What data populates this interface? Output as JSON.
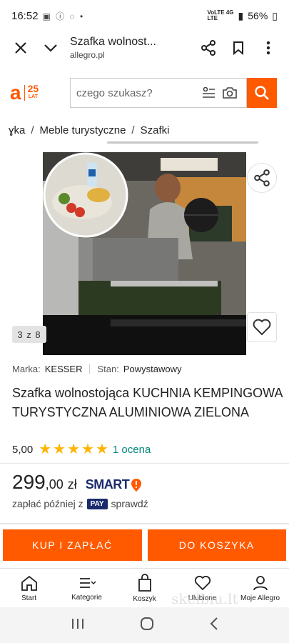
{
  "status_bar": {
    "time": "16:52",
    "battery": "56%",
    "network_top": "VoLTE 4G",
    "network_bottom": "LTE"
  },
  "browser": {
    "title": "Szafka wolnost...",
    "url": "allegro.pl",
    "icons": [
      "close-icon",
      "chevron-down-icon",
      "share-icon",
      "bookmark-icon",
      "more-icon"
    ]
  },
  "header": {
    "logo_letter": "a",
    "logo_anniversary": "25",
    "logo_lat": "LAT",
    "search_placeholder": "czego szukasz?"
  },
  "breadcrumb": [
    {
      "label": "ɣka"
    },
    {
      "label": "Meble turystyczne"
    },
    {
      "label": "Szafki"
    }
  ],
  "gallery": {
    "counter": "3 z 8"
  },
  "product": {
    "brand_label": "Marka:",
    "brand_value": "KESSER",
    "condition_label": "Stan:",
    "condition_value": "Powystawowy",
    "title": "Szafka wolnostojąca KUCHNIA KEMPINGOWA TURYSTYCZNA ALUMINIOWA ZIELONA",
    "rating_value": "5,00",
    "stars": 5,
    "rating_count": "1 ocena",
    "price_main": "299",
    "price_fraction": ",00",
    "currency": "zł",
    "smart_label": "SMART",
    "pay_text_before": "zapłać później z",
    "pay_badge": "PAY",
    "pay_text_after": "sprawdź"
  },
  "actions": {
    "buy_label": "KUP I ZAPŁAĆ",
    "cart_label": "DO KOSZYKA"
  },
  "bottom_nav": [
    {
      "label": "Start",
      "icon": "home-icon"
    },
    {
      "label": "Kategorie",
      "icon": "menu-icon"
    },
    {
      "label": "Koszyk",
      "icon": "cart-icon"
    },
    {
      "label": "Ulubione",
      "icon": "heart-icon"
    },
    {
      "label": "Moje Allegro",
      "icon": "user-icon"
    }
  ],
  "watermark": "skelbiu.lt",
  "colors": {
    "brand": "#ff5a00",
    "rating_link": "#00897b",
    "smart": "#1a2b6d",
    "star": "#ffb400"
  }
}
